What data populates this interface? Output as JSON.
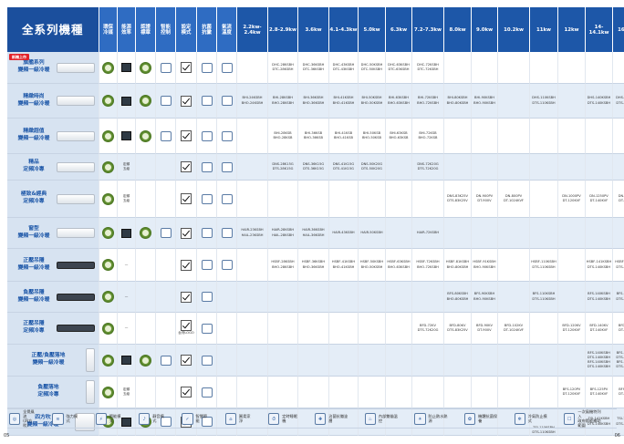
{
  "title": "全系列機種",
  "headers": [
    "環保\n冷媒",
    "能源\n效率",
    "認證\n標章",
    "智能\n控制",
    "設定\n模式",
    "抗菌\n抗黴",
    "氣流\n溫度"
  ],
  "capacities": [
    "2.2kw-2.4kw",
    "2.8-2.9kw",
    "3.6kw",
    "4.1-4.3kw",
    "5.0kw",
    "6.3kw",
    "7.2-7.3kw",
    "8.0kw",
    "9.0kw",
    "10.2kw",
    "11kw",
    "12kw",
    "14-14.1kw",
    "16.0kw"
  ],
  "new_badge": "新機上市",
  "ac_note": "定頻\n五級",
  "dash": "—",
  "small_note": "台灣LOGO",
  "rows": [
    {
      "name": "旗艦系列\n變頻一級冷暖",
      "new": true,
      "models": [
        "",
        "DHC-28KSBH\nDTC-28KSBH",
        "DHC-36KSBH\nDTC-36KSBH",
        "DHC-43KSBH\nDTC-43KSBH",
        "DHC-50KSBH\nDTC-50KSBH",
        "DHC-63KSBH\nDTC-63KSBH",
        "DHC-72KSBH\nDTC-72KSBH",
        "",
        "",
        "",
        "",
        "",
        "",
        ""
      ]
    },
    {
      "name": "精緻時尚\n變頻一級冷暖",
      "models": [
        "BHI-24KSBH\nBHO-24KSBH",
        "BHI-28KSBH\nBHO-28KSBH",
        "BHI-36KSBH\nBHO-36KSBH",
        "BHI-41KSBH\nBHO-41KSBH",
        "BHI-50KSBH\nBHO-50KSBH",
        "BHI-63KSBH\nBHO-63KSBH",
        "BHI-72KSBH\nBHO-72KSBH",
        "BHI-80KSBH\nBHO-80KSBH",
        "BHI-90KSBH\nBHO-90KSBH",
        "",
        "DHS-110KSBH\nDTS-110KSBH",
        "",
        "DHS-140KSBH\nDTS-140KSBH",
        "DHS-160KSBH\nDTS-160KSBH"
      ]
    },
    {
      "name": "精緻超值\n變頻一級冷暖",
      "models": [
        "",
        "BHI-28KSB\nBHO-28KSB",
        "BHI-36KSB\nBHO-36KSB",
        "BHI-41KSB\nBHO-41KSB",
        "BHI-50KSB\nBHO-50KSB",
        "BHI-63KSB\nBHO-63KSB",
        "BHI-72KSB\nBHO-72KSB",
        "",
        "",
        "",
        "",
        "",
        "",
        ""
      ]
    },
    {
      "name": "精品\n定頻冷專",
      "ac": true,
      "models": [
        "",
        "DNS-28K15G\nDTS-28K15G",
        "DNS-36K15G\nDTS-36K15G",
        "DNS-41K15G\nDTS-41K15G",
        "DNS-50K20G\nDTS-50K20G",
        "",
        "DNS-72K20G\nDTS-72K20G",
        "",
        "",
        "",
        "",
        "",
        "",
        ""
      ]
    },
    {
      "name": "極致&經典\n定頻冷專",
      "ac": true,
      "models": [
        "",
        "",
        "",
        "",
        "",
        "",
        "",
        "DNS-83K25V\nDTS-83K25V",
        "DN-900PV\nDT-900V",
        "DN-800PV\nDT-1024KVF",
        "",
        "DN-1000PV\nDT-120KVF",
        "DN-1250PV\nDT-140KVF",
        "DN-1000PV\nDT-160KVF"
      ]
    },
    {
      "name": "窗型\n變頻一級冷暖",
      "models": [
        "HAIR-23KSBH\nHAIL-23KSBH",
        "HAIR-28KSBH\nHAIL-28KSBH",
        "HAIR-36KSBH\nHAIL-36KSBH",
        "HAIR-43KSBH",
        "HAIR-50KSBH",
        "",
        "HAIR-72KSBH",
        "",
        "",
        "",
        "",
        "",
        "",
        ""
      ]
    },
    {
      "name": "正壓吊隱\n變頻一級冷暖",
      "dash": true,
      "models": [
        "",
        "HSBF-28KSBH\nBHO-28KSBH",
        "HSBF-36KSBH\nBHO-36KSBH",
        "HSBF-41KSBH\nBHO-41KSBH",
        "HSBF-50KSBH\nBHO-50KSBH",
        "HSBF-63KSBH\nBHO-63KSBH",
        "HSBF-72KSBH\nBHO-72KSBH",
        "HSBF-81KSBH\nBHO-80KSBH",
        "HSBF-91KSBH\nBHO-90KSBH",
        "",
        "HSBF-110KSBH\nDTS-110KSBH",
        "",
        "HSBF-141KSBH\nDTS-140KSBH",
        "HSBF-160KSBH\nDTS-160KSBH"
      ]
    },
    {
      "name": "負壓吊隱\n變頻一級冷暖",
      "dash": true,
      "models": [
        "",
        "",
        "",
        "",
        "",
        "",
        "",
        "BFS-80KSBH\nBHO-80KSBH",
        "BFS-90KSBH\nBHO-90KSBH",
        "",
        "BFS-110KSBH\nDTS-110KSBH",
        "",
        "BFS-140KSBH\nDTS-140KSBH",
        "BFS-160KSBH\nDTS-160KSBH"
      ]
    },
    {
      "name": "正壓吊隱\n定頻冷專",
      "dash": true,
      "note": true,
      "models": [
        "",
        "",
        "",
        "",
        "",
        "",
        "BFD-72KV\nDTS-72K20G",
        "BFD-80KV\nDTS-83K25V",
        "BFD-90KV\nDT-900V",
        "BFD-102KV\nDT-1024KVF",
        "",
        "BFD-120KV\nDT-120KVF",
        "BFD-140KV\nDT-140KVF",
        "BFD-160KV\nDT-160KVF"
      ]
    },
    {
      "name": "正壓/負壓落地\n變頻一級冷暖",
      "models": [
        "",
        "",
        "",
        "",
        "",
        "",
        "",
        "",
        "",
        "",
        "",
        "",
        "BFS-140KSBH\nDTS-140KSBH\nBFS-140KSBH\nDTS-140KSBH",
        "BFS-160KSBH\nDTS-160KSBH\nBFS-160KSBH\nDTS-160KSBH"
      ]
    },
    {
      "name": "負壓落地\n定頻冷專",
      "ac": true,
      "models": [
        "",
        "",
        "",
        "",
        "",
        "",
        "",
        "",
        "",
        "",
        "",
        "BFS-120PV\nDT-120KVF",
        "BFS-125PV\nDT-140KVF",
        "BFS-150PV\nDT-160KVF"
      ]
    },
    {
      "name": "四方吹\n變頻一級冷暖",
      "models": [
        "",
        "",
        "",
        "",
        "",
        "",
        "",
        "",
        "",
        "",
        "TSI-110KSBH\nDTS-110KSBH",
        "",
        "TSI-141KSBH\nDTS-140KSBH",
        "TSI-160KSBH\nDTS-160KSBH"
      ]
    }
  ],
  "legend": [
    "全覺風流\n(四方吹)",
    "強力模式",
    "節能模式",
    "靜音模式",
    "智慧節能",
    "圓柔家淨",
    "定時睡眠機",
    "治菌抗黴塗層",
    "內部雙貓溫控",
    "防止熱水熱源",
    "機體抗菌保養",
    "冷氣防止模式",
    "一次風機特列入\n政府節能補助範圍"
  ],
  "page_left": "05",
  "page_right": "06"
}
